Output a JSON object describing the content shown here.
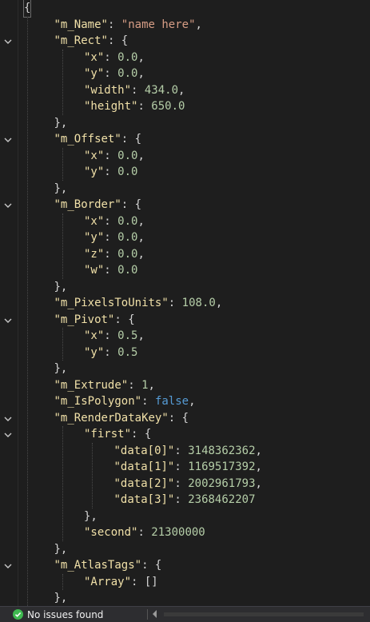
{
  "editor": {
    "lines": [
      {
        "fold": false,
        "indent": 0,
        "tokens": [
          {
            "t": "{",
            "c": "pun cursor-bracket"
          }
        ]
      },
      {
        "fold": false,
        "indent": 1,
        "tokens": [
          {
            "t": "\"m_Name\"",
            "c": "key"
          },
          {
            "t": ": ",
            "c": "pun"
          },
          {
            "t": "\"name here\"",
            "c": "str"
          },
          {
            "t": ",",
            "c": "pun"
          }
        ]
      },
      {
        "fold": true,
        "indent": 1,
        "tokens": [
          {
            "t": "\"m_Rect\"",
            "c": "key"
          },
          {
            "t": ": {",
            "c": "pun"
          }
        ]
      },
      {
        "fold": false,
        "indent": 2,
        "tokens": [
          {
            "t": "\"x\"",
            "c": "key"
          },
          {
            "t": ": ",
            "c": "pun"
          },
          {
            "t": "0.0",
            "c": "num"
          },
          {
            "t": ",",
            "c": "pun"
          }
        ]
      },
      {
        "fold": false,
        "indent": 2,
        "tokens": [
          {
            "t": "\"y\"",
            "c": "key"
          },
          {
            "t": ": ",
            "c": "pun"
          },
          {
            "t": "0.0",
            "c": "num"
          },
          {
            "t": ",",
            "c": "pun"
          }
        ]
      },
      {
        "fold": false,
        "indent": 2,
        "tokens": [
          {
            "t": "\"width\"",
            "c": "key"
          },
          {
            "t": ": ",
            "c": "pun"
          },
          {
            "t": "434.0",
            "c": "num"
          },
          {
            "t": ",",
            "c": "pun"
          }
        ]
      },
      {
        "fold": false,
        "indent": 2,
        "tokens": [
          {
            "t": "\"height\"",
            "c": "key"
          },
          {
            "t": ": ",
            "c": "pun"
          },
          {
            "t": "650.0",
            "c": "num"
          }
        ]
      },
      {
        "fold": false,
        "indent": 1,
        "tokens": [
          {
            "t": "},",
            "c": "pun"
          }
        ]
      },
      {
        "fold": true,
        "indent": 1,
        "tokens": [
          {
            "t": "\"m_Offset\"",
            "c": "key"
          },
          {
            "t": ": {",
            "c": "pun"
          }
        ]
      },
      {
        "fold": false,
        "indent": 2,
        "tokens": [
          {
            "t": "\"x\"",
            "c": "key"
          },
          {
            "t": ": ",
            "c": "pun"
          },
          {
            "t": "0.0",
            "c": "num"
          },
          {
            "t": ",",
            "c": "pun"
          }
        ]
      },
      {
        "fold": false,
        "indent": 2,
        "tokens": [
          {
            "t": "\"y\"",
            "c": "key"
          },
          {
            "t": ": ",
            "c": "pun"
          },
          {
            "t": "0.0",
            "c": "num"
          }
        ]
      },
      {
        "fold": false,
        "indent": 1,
        "tokens": [
          {
            "t": "},",
            "c": "pun"
          }
        ]
      },
      {
        "fold": true,
        "indent": 1,
        "tokens": [
          {
            "t": "\"m_Border\"",
            "c": "key"
          },
          {
            "t": ": {",
            "c": "pun"
          }
        ]
      },
      {
        "fold": false,
        "indent": 2,
        "tokens": [
          {
            "t": "\"x\"",
            "c": "key"
          },
          {
            "t": ": ",
            "c": "pun"
          },
          {
            "t": "0.0",
            "c": "num"
          },
          {
            "t": ",",
            "c": "pun"
          }
        ]
      },
      {
        "fold": false,
        "indent": 2,
        "tokens": [
          {
            "t": "\"y\"",
            "c": "key"
          },
          {
            "t": ": ",
            "c": "pun"
          },
          {
            "t": "0.0",
            "c": "num"
          },
          {
            "t": ",",
            "c": "pun"
          }
        ]
      },
      {
        "fold": false,
        "indent": 2,
        "tokens": [
          {
            "t": "\"z\"",
            "c": "key"
          },
          {
            "t": ": ",
            "c": "pun"
          },
          {
            "t": "0.0",
            "c": "num"
          },
          {
            "t": ",",
            "c": "pun"
          }
        ]
      },
      {
        "fold": false,
        "indent": 2,
        "tokens": [
          {
            "t": "\"w\"",
            "c": "key"
          },
          {
            "t": ": ",
            "c": "pun"
          },
          {
            "t": "0.0",
            "c": "num"
          }
        ]
      },
      {
        "fold": false,
        "indent": 1,
        "tokens": [
          {
            "t": "},",
            "c": "pun"
          }
        ]
      },
      {
        "fold": false,
        "indent": 1,
        "tokens": [
          {
            "t": "\"m_PixelsToUnits\"",
            "c": "key"
          },
          {
            "t": ": ",
            "c": "pun"
          },
          {
            "t": "108.0",
            "c": "num"
          },
          {
            "t": ",",
            "c": "pun"
          }
        ]
      },
      {
        "fold": true,
        "indent": 1,
        "tokens": [
          {
            "t": "\"m_Pivot\"",
            "c": "key"
          },
          {
            "t": ": {",
            "c": "pun"
          }
        ]
      },
      {
        "fold": false,
        "indent": 2,
        "tokens": [
          {
            "t": "\"x\"",
            "c": "key"
          },
          {
            "t": ": ",
            "c": "pun"
          },
          {
            "t": "0.5",
            "c": "num"
          },
          {
            "t": ",",
            "c": "pun"
          }
        ]
      },
      {
        "fold": false,
        "indent": 2,
        "tokens": [
          {
            "t": "\"y\"",
            "c": "key"
          },
          {
            "t": ": ",
            "c": "pun"
          },
          {
            "t": "0.5",
            "c": "num"
          }
        ]
      },
      {
        "fold": false,
        "indent": 1,
        "tokens": [
          {
            "t": "},",
            "c": "pun"
          }
        ]
      },
      {
        "fold": false,
        "indent": 1,
        "tokens": [
          {
            "t": "\"m_Extrude\"",
            "c": "key"
          },
          {
            "t": ": ",
            "c": "pun"
          },
          {
            "t": "1",
            "c": "num"
          },
          {
            "t": ",",
            "c": "pun"
          }
        ]
      },
      {
        "fold": false,
        "indent": 1,
        "tokens": [
          {
            "t": "\"m_IsPolygon\"",
            "c": "key"
          },
          {
            "t": ": ",
            "c": "pun"
          },
          {
            "t": "false",
            "c": "kw"
          },
          {
            "t": ",",
            "c": "pun"
          }
        ]
      },
      {
        "fold": true,
        "indent": 1,
        "tokens": [
          {
            "t": "\"m_RenderDataKey\"",
            "c": "key"
          },
          {
            "t": ": {",
            "c": "pun"
          }
        ]
      },
      {
        "fold": true,
        "indent": 2,
        "tokens": [
          {
            "t": "\"first\"",
            "c": "key"
          },
          {
            "t": ": {",
            "c": "pun"
          }
        ]
      },
      {
        "fold": false,
        "indent": 3,
        "tokens": [
          {
            "t": "\"data[0]\"",
            "c": "key"
          },
          {
            "t": ": ",
            "c": "pun"
          },
          {
            "t": "3148362362",
            "c": "num"
          },
          {
            "t": ",",
            "c": "pun"
          }
        ]
      },
      {
        "fold": false,
        "indent": 3,
        "tokens": [
          {
            "t": "\"data[1]\"",
            "c": "key"
          },
          {
            "t": ": ",
            "c": "pun"
          },
          {
            "t": "1169517392",
            "c": "num"
          },
          {
            "t": ",",
            "c": "pun"
          }
        ]
      },
      {
        "fold": false,
        "indent": 3,
        "tokens": [
          {
            "t": "\"data[2]\"",
            "c": "key"
          },
          {
            "t": ": ",
            "c": "pun"
          },
          {
            "t": "2002961793",
            "c": "num"
          },
          {
            "t": ",",
            "c": "pun"
          }
        ]
      },
      {
        "fold": false,
        "indent": 3,
        "tokens": [
          {
            "t": "\"data[3]\"",
            "c": "key"
          },
          {
            "t": ": ",
            "c": "pun"
          },
          {
            "t": "2368462207",
            "c": "num"
          }
        ]
      },
      {
        "fold": false,
        "indent": 2,
        "tokens": [
          {
            "t": "},",
            "c": "pun"
          }
        ]
      },
      {
        "fold": false,
        "indent": 2,
        "tokens": [
          {
            "t": "\"second\"",
            "c": "key"
          },
          {
            "t": ": ",
            "c": "pun"
          },
          {
            "t": "21300000",
            "c": "num"
          }
        ]
      },
      {
        "fold": false,
        "indent": 1,
        "tokens": [
          {
            "t": "},",
            "c": "pun"
          }
        ]
      },
      {
        "fold": true,
        "indent": 1,
        "tokens": [
          {
            "t": "\"m_AtlasTags\"",
            "c": "key"
          },
          {
            "t": ": {",
            "c": "pun"
          }
        ]
      },
      {
        "fold": false,
        "indent": 2,
        "tokens": [
          {
            "t": "\"Array\"",
            "c": "key"
          },
          {
            "t": ": ",
            "c": "pun"
          },
          {
            "t": "[]",
            "c": "pun"
          }
        ]
      },
      {
        "fold": false,
        "indent": 1,
        "tokens": [
          {
            "t": "},",
            "c": "pun"
          }
        ]
      }
    ]
  },
  "status_bar": {
    "status_text": "No issues found",
    "status_icon": "check-circle-icon",
    "status_color": "#3fb950"
  },
  "colors": {
    "background": "#1e1e1e",
    "key": "#f0e0a8",
    "string": "#d69d85",
    "number": "#b5cea8",
    "keyword": "#569cd6"
  }
}
